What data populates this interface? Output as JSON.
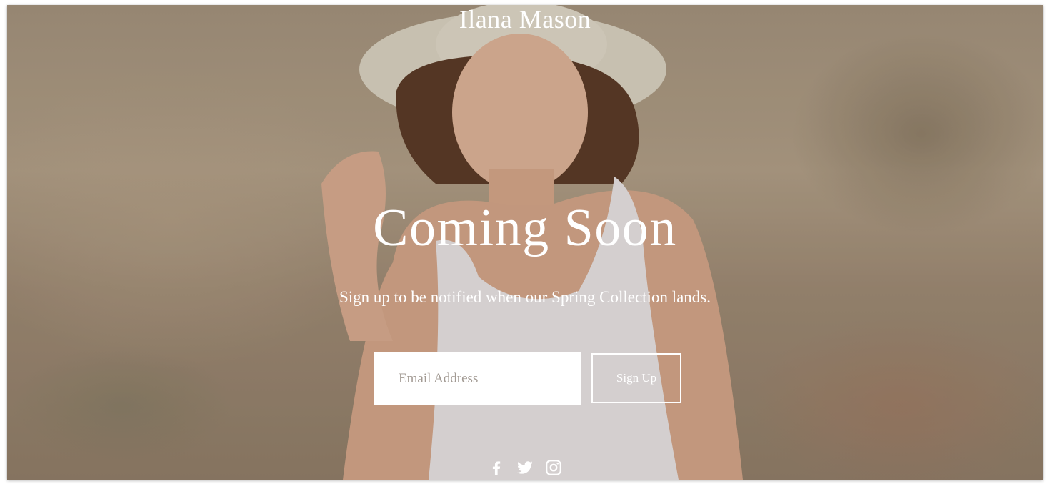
{
  "header": {
    "brand": "Ilana Mason"
  },
  "hero": {
    "title": "Coming Soon",
    "subtitle": "Sign up to be notified when our Spring Collection lands."
  },
  "signup_form": {
    "email_placeholder": "Email Address",
    "email_value": "",
    "button_label": "Sign Up"
  },
  "social": {
    "icons": [
      "facebook-icon",
      "twitter-icon",
      "instagram-icon"
    ]
  },
  "colors": {
    "text": "#ffffff",
    "input_bg": "#ffffff",
    "placeholder": "#a29a93"
  }
}
